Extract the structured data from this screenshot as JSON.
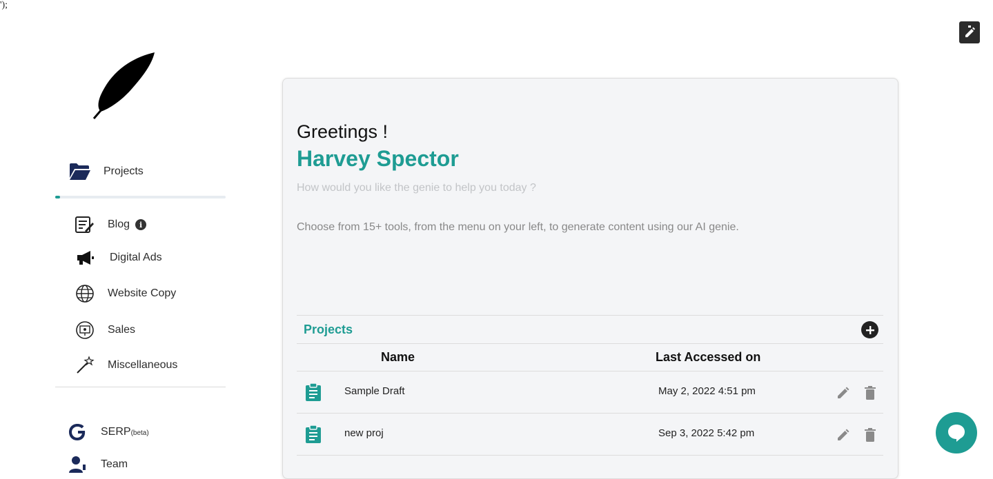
{
  "stray_text": "');",
  "sidebar": {
    "main_item": {
      "label": "Projects",
      "icon": "folder-open-icon"
    },
    "progress_percent": 3,
    "items": [
      {
        "label": "Blog",
        "icon": "notes-icon",
        "info": "i"
      },
      {
        "label": "Digital Ads",
        "icon": "megaphone-icon"
      },
      {
        "label": "Website Copy",
        "icon": "globe-icon"
      },
      {
        "label": "Sales",
        "icon": "presentation-icon"
      },
      {
        "label": "Miscellaneous",
        "icon": "magic-wand-icon"
      }
    ],
    "bottom_items": [
      {
        "label": "SERP",
        "suffix": "(beta)",
        "icon": "google-g-icon"
      },
      {
        "label": "Team",
        "icon": "team-icon"
      }
    ]
  },
  "main": {
    "greeting": "Greetings !",
    "user_name": "Harvey Spector",
    "help_text": "How would you like the genie to help you today ?",
    "choose_text": "Choose from 15+ tools, from the menu on your left, to generate content using our AI genie.",
    "projects": {
      "title": "Projects",
      "columns": {
        "name": "Name",
        "last_accessed": "Last Accessed on"
      },
      "rows": [
        {
          "name": "Sample Draft",
          "last_accessed": "May 2, 2022 4:51 pm"
        },
        {
          "name": "new proj",
          "last_accessed": "Sep 3, 2022 5:42 pm"
        }
      ]
    }
  },
  "colors": {
    "accent": "#1e9c93",
    "nav_icon": "#1b2a5a",
    "dark": "#222222"
  }
}
